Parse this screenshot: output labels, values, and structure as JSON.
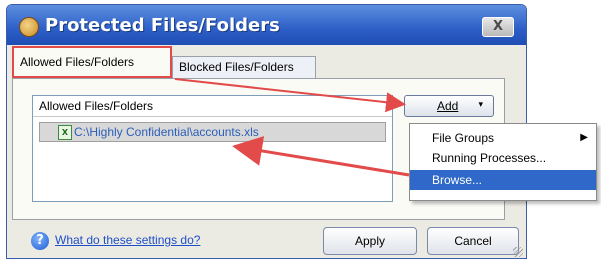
{
  "window": {
    "title": "Protected Files/Folders",
    "close_label": "X"
  },
  "tabs": [
    {
      "label": "Allowed Files/Folders",
      "active": true
    },
    {
      "label": "Blocked Files/Folders",
      "active": false
    }
  ],
  "list": {
    "header": "Allowed Files/Folders",
    "rows": [
      {
        "icon": "xls-file-icon",
        "path": "C:\\Highly Confidential\\accounts.xls"
      }
    ]
  },
  "add_button": {
    "label": "Add",
    "caret": "▾"
  },
  "menu": {
    "items": [
      {
        "label": "File Groups",
        "has_submenu": true
      },
      {
        "label": "Running Processes..."
      },
      {
        "label": "Browse...",
        "highlighted": true
      }
    ],
    "submenu_caret": "▶"
  },
  "footer": {
    "help_icon_text": "?",
    "help_link": "What do these settings do?",
    "apply_label": "Apply",
    "cancel_label": "Cancel"
  },
  "colors": {
    "titlebar": "#2d5fc8",
    "highlight": "#2f68c8",
    "annotation_red": "#e34a4a"
  }
}
